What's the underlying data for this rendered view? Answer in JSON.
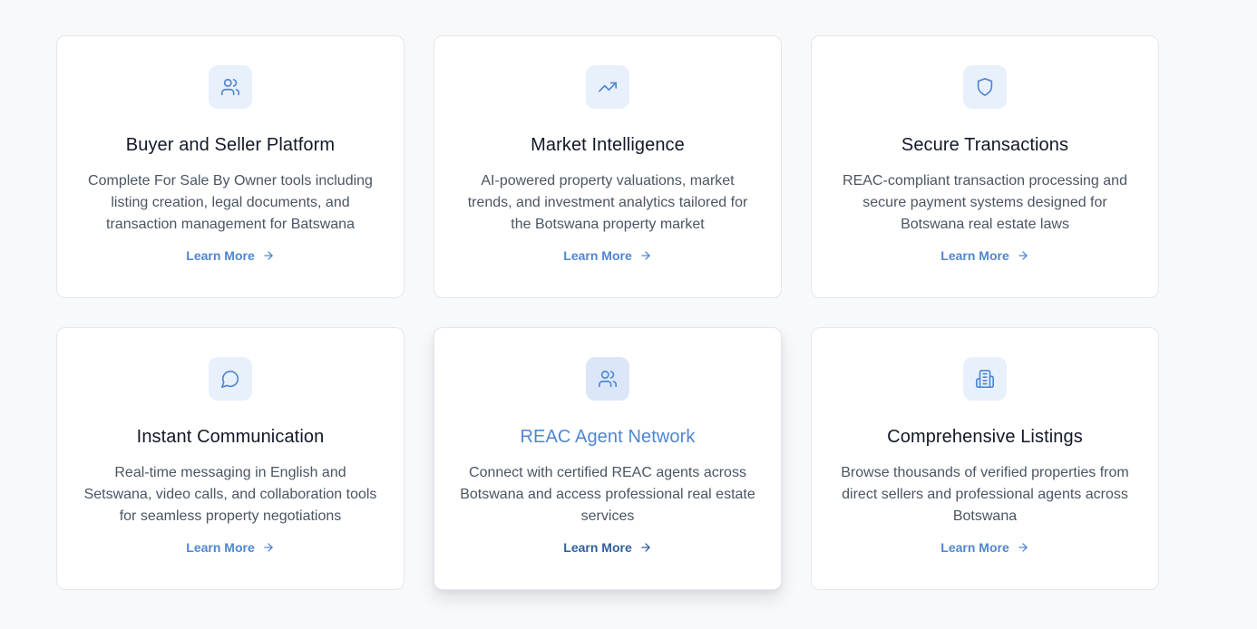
{
  "colors": {
    "accent": "#4f86d3",
    "icon_bg": "#e8f0fc",
    "card_border": "#e5e7eb",
    "page_bg": "#f8f9fb"
  },
  "cards": [
    {
      "icon": "users-icon",
      "title": "Buyer and Seller Platform",
      "description": "Complete For Sale By Owner tools including listing creation, legal documents, and transaction management for Batswana",
      "link_label": "Learn More"
    },
    {
      "icon": "trending-up-icon",
      "title": "Market Intelligence",
      "description": "AI-powered property valuations, market trends, and investment analytics tailored for the Botswana property market",
      "link_label": "Learn More"
    },
    {
      "icon": "shield-icon",
      "title": "Secure Transactions",
      "description": "REAC-compliant transaction processing and secure payment systems designed for Botswana real estate laws",
      "link_label": "Learn More"
    },
    {
      "icon": "message-circle-icon",
      "title": "Instant Communication",
      "description": "Real-time messaging in English and Setswana, video calls, and collaboration tools for seamless property negotiations",
      "link_label": "Learn More"
    },
    {
      "icon": "users-icon",
      "title": "REAC Agent Network",
      "description": "Connect with certified REAC agents across Botswana and access professional real estate services",
      "link_label": "Learn More"
    },
    {
      "icon": "building-icon",
      "title": "Comprehensive Listings",
      "description": "Browse thousands of verified properties from direct sellers and professional agents across Botswana",
      "link_label": "Learn More"
    }
  ]
}
